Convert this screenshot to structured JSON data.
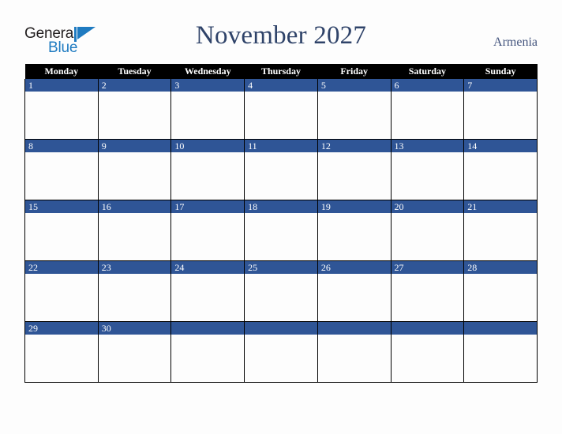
{
  "brand": {
    "name_part1": "General",
    "name_part2": "Blue",
    "mark": "flag-triangle-icon",
    "color_dark": "#231f20",
    "color_blue": "#1f7bc1"
  },
  "header": {
    "title": "November 2027",
    "country": "Armenia",
    "title_color": "#2f4369",
    "country_color": "#44557e"
  },
  "calendar": {
    "month": "November",
    "year": "2027",
    "header_bg": "#000000",
    "header_fg": "#ffffff",
    "day_band_bg": "#2f5596",
    "day_band_fg": "#ffffff",
    "cell_bg": "#fdfdfd",
    "grid_line": "#000000",
    "weekdays": [
      "Monday",
      "Tuesday",
      "Wednesday",
      "Thursday",
      "Friday",
      "Saturday",
      "Sunday"
    ],
    "weeks": [
      [
        "1",
        "2",
        "3",
        "4",
        "5",
        "6",
        "7"
      ],
      [
        "8",
        "9",
        "10",
        "11",
        "12",
        "13",
        "14"
      ],
      [
        "15",
        "16",
        "17",
        "18",
        "19",
        "20",
        "21"
      ],
      [
        "22",
        "23",
        "24",
        "25",
        "26",
        "27",
        "28"
      ],
      [
        "29",
        "30",
        "",
        "",
        "",
        "",
        ""
      ]
    ]
  }
}
